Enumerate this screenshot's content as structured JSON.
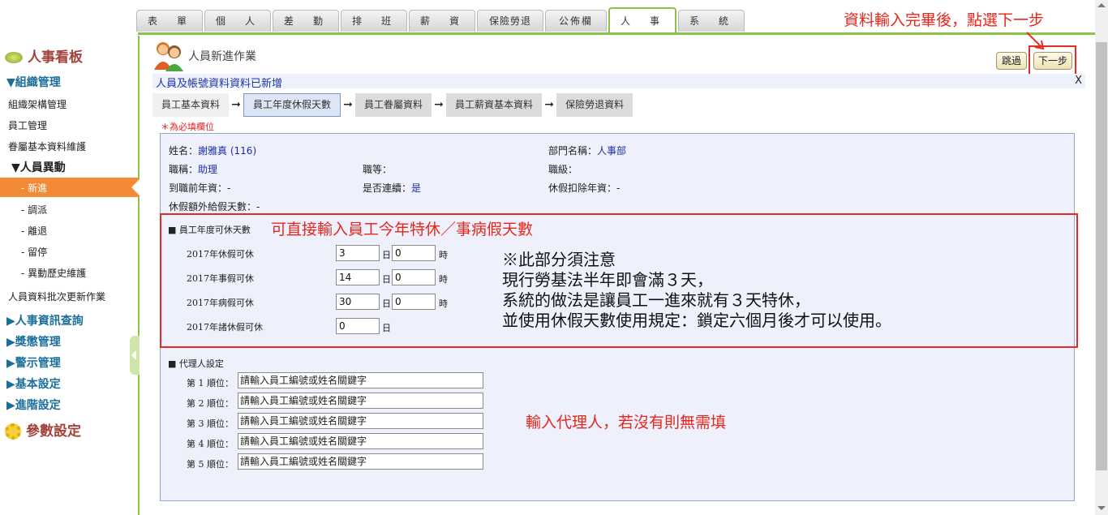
{
  "tabs": [
    "表　單",
    "個　人",
    "差　勤",
    "排　班",
    "薪　資",
    "保險勞退",
    "公佈欄",
    "人　事",
    "系　統"
  ],
  "active_tab": "人　事",
  "annotations": {
    "top_right": "資料輸入完畢後，點選下一步",
    "leave_box": "可直接輸入員工今年特休／事病假天數",
    "agent": "輸入代理人，若沒有則無需填",
    "note_lines": [
      "※此部分須注意",
      "現行勞基法半年即會滿３天，",
      "系統的做法是讓員工一進來就有３天特休，",
      "並使用休假天數使用規定：鎖定六個月後才可以使用。"
    ]
  },
  "sidebar": {
    "title": "人事看板",
    "org_header": "▼組織管理",
    "org_items": [
      "組織架構管理",
      "員工管理",
      "眷屬基本資料維護"
    ],
    "move_header": "▼人員異動",
    "move_items": [
      "- 新進",
      "- 調派",
      "- 離退",
      "- 留停",
      "- 異動歷史維護"
    ],
    "batch_item": "人員資料批次更新作業",
    "collapsed": [
      "▶人事資訊查詢",
      "▶獎懲管理",
      "▶警示管理",
      "▶基本設定",
      "▶進階設定"
    ],
    "param": "參數設定"
  },
  "page": {
    "title": "人員新進作業",
    "skip": "跳過",
    "next": "下一步",
    "message": "人員及帳號資料資料已新增",
    "close": "X",
    "steps": [
      "員工基本資料",
      "員工年度休假天數",
      "員工眷屬資料",
      "員工薪資基本資料",
      "保險勞退資料"
    ],
    "required_note": "＊為必填欄位"
  },
  "info": {
    "name_label": "姓名：",
    "name_value": "謝雅真",
    "name_id": "(116)",
    "dept_label": "部門名稱：",
    "dept_value": "人事部",
    "title_label": "職稱：",
    "title_value": "助理",
    "grade_label": "職等：",
    "level_label": "職級：",
    "prev_label": "到職前年資：",
    "prev_value": "-",
    "cont_label": "是否連續：",
    "cont_value": "是",
    "deduct_label": "休假扣除年資：",
    "deduct_value": "-",
    "extra_label": "休假額外給假天數：",
    "extra_value": "-"
  },
  "leave": {
    "section": "■ 員工年度可休天數",
    "day_unit": "日",
    "hour_unit": "時",
    "rows": [
      {
        "label": "2017年休假可休",
        "days": "3",
        "hours": "0"
      },
      {
        "label": "2017年事假可休",
        "days": "14",
        "hours": "0"
      },
      {
        "label": "2017年病假可休",
        "days": "30",
        "hours": "0"
      },
      {
        "label": "2017年諸休假可休",
        "days": "0",
        "hours": ""
      }
    ]
  },
  "agents": {
    "section": "■ 代理人設定",
    "placeholder": "請輸入員工編號或姓名關鍵字",
    "labels": [
      "第 1 順位：",
      "第 2 順位：",
      "第 3 順位：",
      "第 4 順位：",
      "第 5 順位："
    ]
  },
  "colors": {
    "accent_green": "#8bc34a",
    "annotation_red": "#e52b26",
    "active_orange": "#f28a36",
    "panel_bg": "#eef0fb"
  }
}
